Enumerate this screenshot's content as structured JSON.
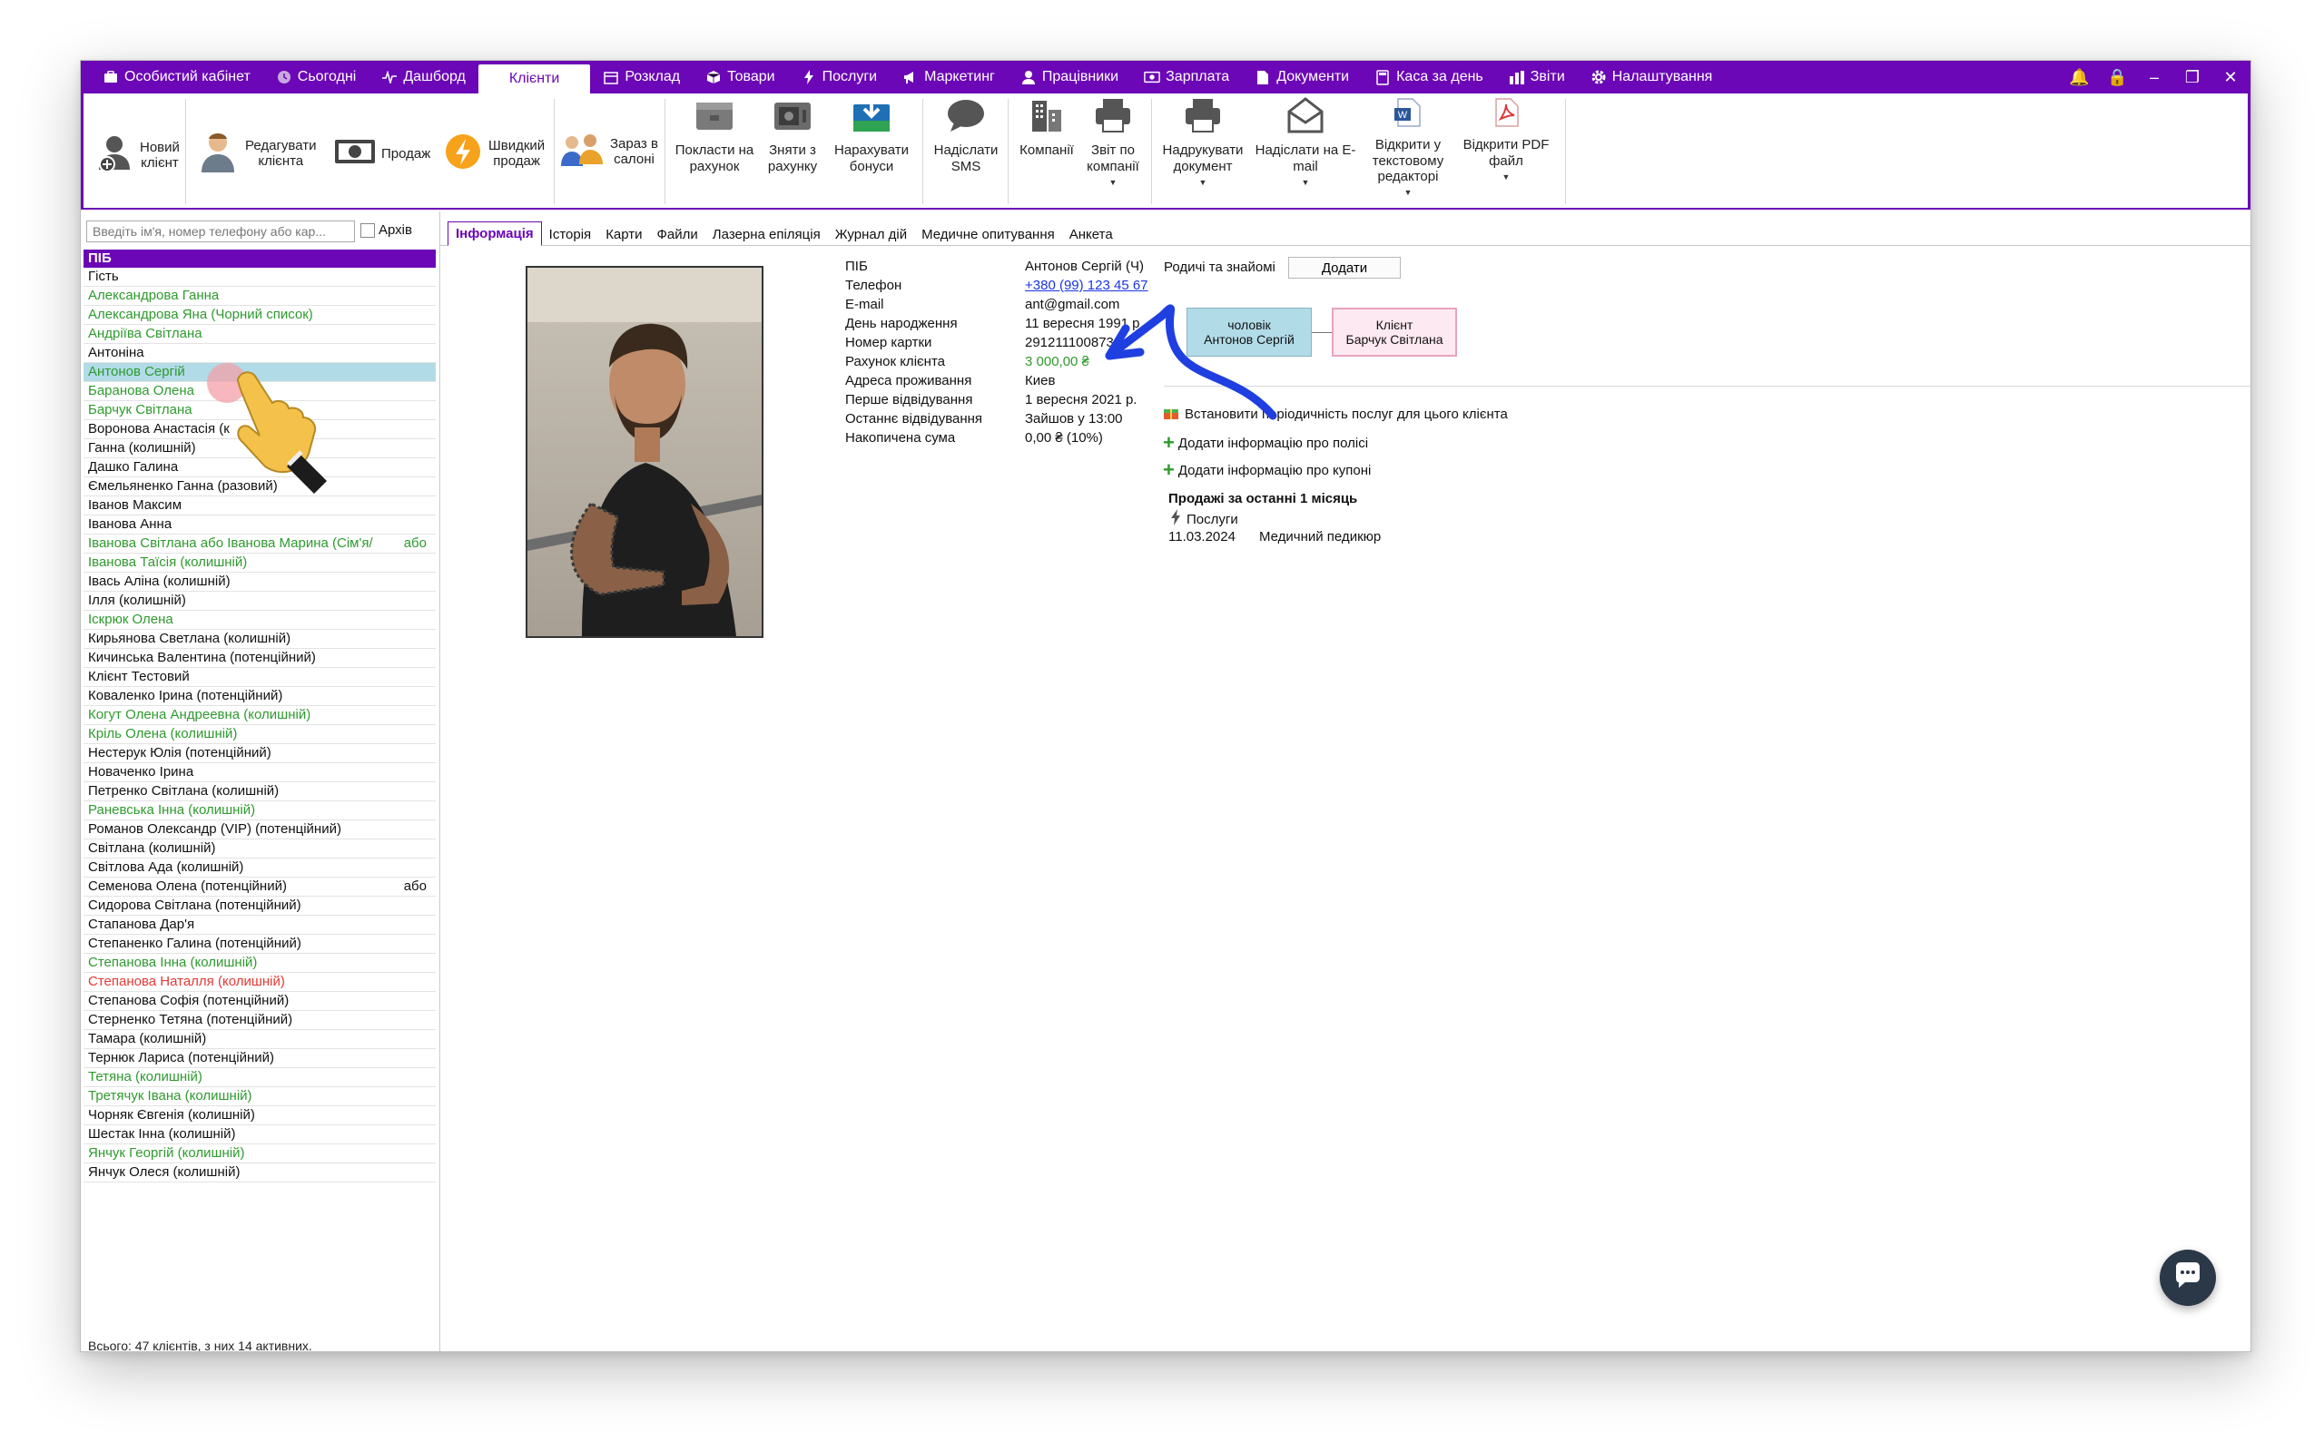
{
  "menu": {
    "items": [
      {
        "label": "Особистий кабінет",
        "icon": "briefcase-icon"
      },
      {
        "label": "Сьогодні",
        "icon": "clock-icon"
      },
      {
        "label": "Дашборд",
        "icon": "pulse-icon"
      },
      {
        "label": "Клієнти",
        "icon": "",
        "active": true
      },
      {
        "label": "Розклад",
        "icon": "calendar-icon"
      },
      {
        "label": "Товари",
        "icon": "box-icon"
      },
      {
        "label": "Послуги",
        "icon": "lightning-icon"
      },
      {
        "label": "Маркетинг",
        "icon": "megaphone-icon"
      },
      {
        "label": "Працівники",
        "icon": "person-icon"
      },
      {
        "label": "Зарплата",
        "icon": "money-icon"
      },
      {
        "label": "Документи",
        "icon": "document-icon"
      },
      {
        "label": "Каса за день",
        "icon": "calculator-icon"
      },
      {
        "label": "Звіти",
        "icon": "bar-chart-icon"
      },
      {
        "label": "Налаштування",
        "icon": "gear-icon"
      }
    ]
  },
  "toolbar": {
    "new_client": "Новий\nклієнт",
    "edit_client": "Редагувати\nклієнта",
    "sale": "Продаж",
    "quick_sale": "Швидкий\nпродаж",
    "in_salon": "Зараз в\nсалоні",
    "put_account": "Покласти на\nрахунок",
    "withdraw_account": "Зняти з\nрахунку",
    "accrue_bonus": "Нарахувати\nбонуси",
    "send_sms": "Надіслати\nSMS",
    "companies": "Компанії",
    "report_companies": "Звіт по\nкомпанії",
    "print_document": "Надрукувати\nдокумент",
    "send_email": "Надіслати на E-\nmail",
    "open_text_editor": "Відкрити у\nтекстовому\nредакторі",
    "open_pdf": "Відкрити PDF\nфайл"
  },
  "search": {
    "placeholder": "Введіть ім'я, номер телефону або кар...",
    "archive_label": "Архів"
  },
  "client_list": {
    "header": "ПІБ",
    "rows": [
      {
        "name": "Гість",
        "color": "black"
      },
      {
        "name": "Александрова Ганна",
        "color": "green"
      },
      {
        "name": "Александрова Яна (Чорний список)",
        "color": "green"
      },
      {
        "name": "Андріїва Світлана",
        "color": "green"
      },
      {
        "name": "Антоніна",
        "color": "black"
      },
      {
        "name": "Антонов Сергій",
        "color": "green",
        "selected": true
      },
      {
        "name": "Баранова Олена",
        "color": "green"
      },
      {
        "name": "Барчук Світлана",
        "color": "green"
      },
      {
        "name": "Воронова Анастасія (к",
        "color": "black"
      },
      {
        "name": "Ганна (колишній)",
        "color": "black"
      },
      {
        "name": "Дашко Галина",
        "color": "black"
      },
      {
        "name": "Ємельяненко Ганна (разовий)",
        "color": "black"
      },
      {
        "name": "Іванов Максим",
        "color": "black"
      },
      {
        "name": "Іванова Анна",
        "color": "black"
      },
      {
        "name": "Іванова Світлана або Іванова Марина (Сім'я/",
        "color": "green",
        "extra": "або"
      },
      {
        "name": "Іванова Таїсія (колишній)",
        "color": "green"
      },
      {
        "name": "Івась Аліна (колишній)",
        "color": "black"
      },
      {
        "name": "Ілля (колишній)",
        "color": "black"
      },
      {
        "name": "Іскрюк Олена",
        "color": "green"
      },
      {
        "name": "Кирьянова Светлана (колишній)",
        "color": "black"
      },
      {
        "name": "Кичинська Валентина (потенційний)",
        "color": "black"
      },
      {
        "name": "Клієнт Тестовий",
        "color": "black"
      },
      {
        "name": "Коваленко Ірина (потенційний)",
        "color": "black"
      },
      {
        "name": "Когут Олена Андреевна (колишній)",
        "color": "green"
      },
      {
        "name": "Кріль Олена (колишній)",
        "color": "green"
      },
      {
        "name": "Нестерук Юлія (потенційний)",
        "color": "black"
      },
      {
        "name": "Новаченко Ірина",
        "color": "black"
      },
      {
        "name": "Петренко Світлана (колишній)",
        "color": "black"
      },
      {
        "name": "Раневська Інна (колишній)",
        "color": "green"
      },
      {
        "name": "Романов Олександр (VIP) (потенційний)",
        "color": "black"
      },
      {
        "name": "Світлана (колишній)",
        "color": "black"
      },
      {
        "name": "Світлова Ада (колишній)",
        "color": "black"
      },
      {
        "name": "Семенова Олена (потенційний)",
        "color": "black",
        "extra": "або"
      },
      {
        "name": "Сидорова Світлана (потенційний)",
        "color": "black"
      },
      {
        "name": "Стапанова Дар'я",
        "color": "black"
      },
      {
        "name": "Степаненко Галина (потенційний)",
        "color": "black"
      },
      {
        "name": "Степанова Інна (колишній)",
        "color": "green"
      },
      {
        "name": "Степанова Наталля (колишній)",
        "color": "red"
      },
      {
        "name": "Степанова Софія (потенційний)",
        "color": "black"
      },
      {
        "name": "Стерненко Тетяна (потенційний)",
        "color": "black"
      },
      {
        "name": "Тамара (колишній)",
        "color": "black"
      },
      {
        "name": "Тернюк Лариса (потенційний)",
        "color": "black"
      },
      {
        "name": "Тетяна (колишній)",
        "color": "green"
      },
      {
        "name": "Третячук Івана (колишній)",
        "color": "green"
      },
      {
        "name": "Чорняк Євгенія (колишній)",
        "color": "black"
      },
      {
        "name": "Шестак Інна (колишній)",
        "color": "black"
      },
      {
        "name": "Янчук Георгій (колишній)",
        "color": "green"
      },
      {
        "name": "Янчук Олеся (колишній)",
        "color": "black"
      }
    ],
    "footer": "Всього: 47 клієнтів, з них 14 активних."
  },
  "tabs": [
    "Інформація",
    "Історія",
    "Карти",
    "Файли",
    "Лазерна епіляція",
    "Журнал дій",
    "Медичне опитування",
    "Анкета"
  ],
  "client_info": {
    "rows": [
      {
        "label": "ПІБ",
        "value": "Антонов Сергій (Ч)",
        "style": ""
      },
      {
        "label": "Телефон",
        "value": "+380 (99) 123 45 67",
        "style": "link"
      },
      {
        "label": "E-mail",
        "value": "ant@gmail.com",
        "style": ""
      },
      {
        "label": "День народження",
        "value": "11 вересня 1991 р",
        "style": ""
      },
      {
        "label": "Номер картки",
        "value": "2912111008739",
        "style": ""
      },
      {
        "label": "Рахунок клієнта",
        "value": "3 000,00 ₴",
        "style": "money"
      },
      {
        "label": "Адреса проживання",
        "value": "Киев",
        "style": ""
      },
      {
        "label": "Перше відвідування",
        "value": "1 вересня 2021 р.",
        "style": ""
      },
      {
        "label": "Останнє відвідування",
        "value": "Зайшов у 13:00",
        "style": ""
      },
      {
        "label": "Накопичена сума",
        "value": "0,00 ₴ (10%)",
        "style": ""
      }
    ]
  },
  "relatives": {
    "label": "Родичі та знайомі",
    "add_button": "Додати",
    "husband_role": "чоловік",
    "husband_name": "Антонов Сергій",
    "client_role": "Клієнт",
    "client_name": "Барчук Світлана"
  },
  "actions": {
    "periodicity": "Встановити періодичність послуг для цього клієнта",
    "add_policy": "Додати інформацію про полісі",
    "add_coupon": "Додати інформацію про купоні"
  },
  "sales": {
    "title": "Продажі за останні 1 місяць",
    "category": "Послуги",
    "date": "11.03.2024",
    "service": "Медичний педикюр"
  },
  "colors": {
    "accent": "#6b07b6",
    "green": "#2e9a2e",
    "red": "#e53935",
    "selected_row": "#b1dbe7",
    "arrow": "#1f3fe0"
  }
}
